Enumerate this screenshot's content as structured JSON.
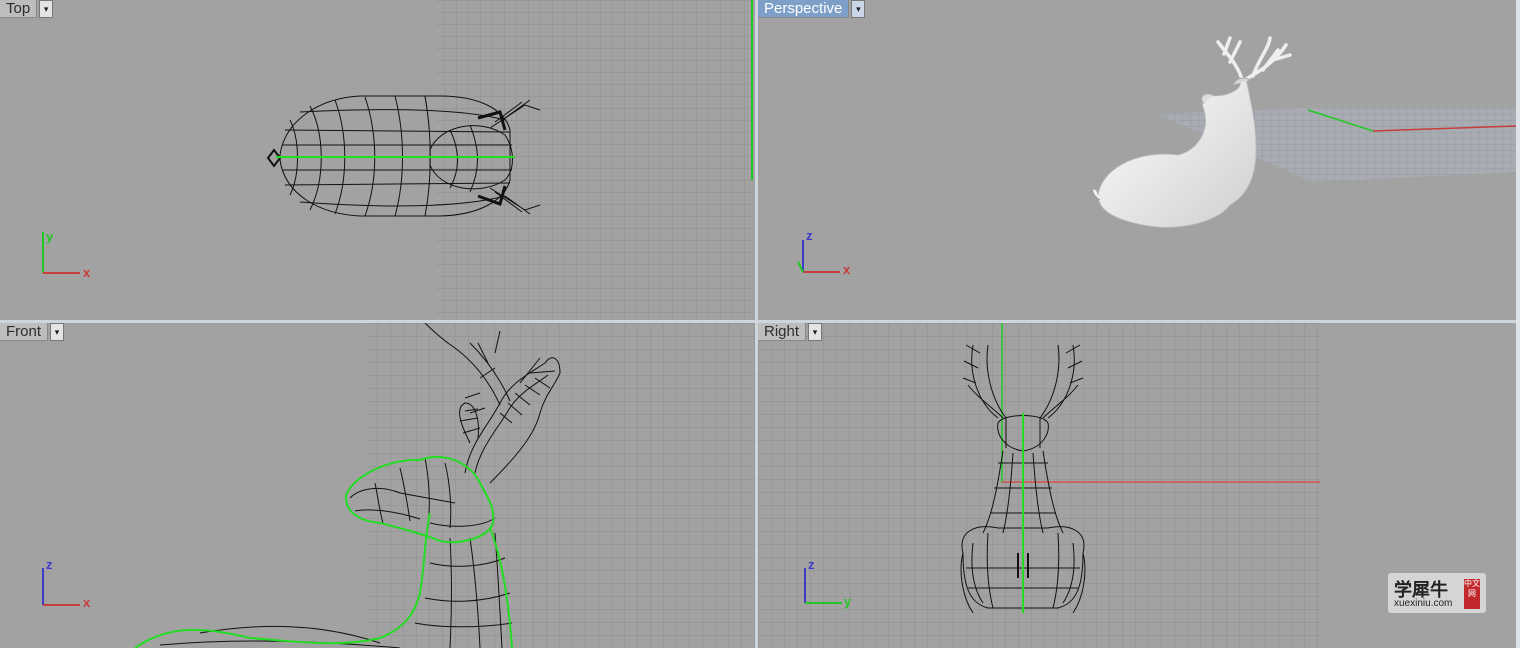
{
  "viewports": {
    "top": {
      "label": "Top",
      "axis_1": "y",
      "axis_2": "x"
    },
    "perspective": {
      "label": "Perspective",
      "axis_1": "z",
      "axis_2": "x"
    },
    "front": {
      "label": "Front",
      "axis_1": "z",
      "axis_2": "x"
    },
    "right": {
      "label": "Right",
      "axis_1": "z",
      "axis_2": "y"
    }
  },
  "dropdown_glyph": "▾",
  "watermark": {
    "main": "学犀牛",
    "url": "xuexiniu.com",
    "badge": "中文网"
  },
  "colors": {
    "viewport_bg": "#a2a2a2",
    "grid": "#8f8f8f",
    "selection_curve": "#22dd22",
    "x_axis": "#c83c3c",
    "y_axis": "#22c822",
    "z_axis": "#3c3cc8",
    "active_label": "#7ea0c8"
  }
}
